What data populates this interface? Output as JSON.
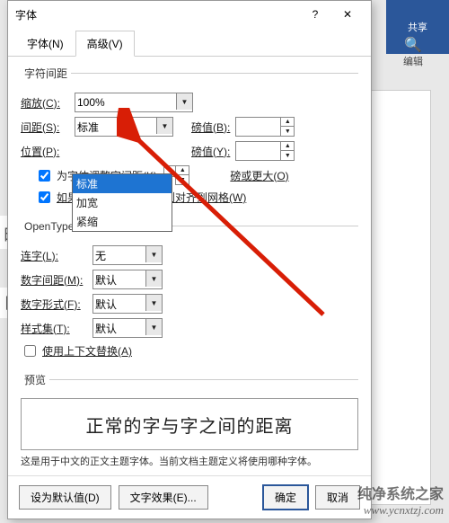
{
  "ribbon": {
    "share": "共享"
  },
  "edit_group": {
    "label": "编辑",
    "icon": "🔍"
  },
  "bg": {
    "left1": "的",
    "left2": "巨"
  },
  "dialog": {
    "title": "字体",
    "help": "?",
    "close": "✕",
    "tabs": {
      "font": "字体(N)",
      "advanced": "高级(V)"
    },
    "char_spacing": {
      "legend": "字符间距",
      "scale_label": "缩放(C):",
      "scale_value": "100%",
      "spacing_label": "间距(S):",
      "spacing_value": "标准",
      "spacing_options": {
        "standard": "标准",
        "expanded": "加宽",
        "condensed": "紧缩"
      },
      "position_label": "位置(P):",
      "position_value": "",
      "by_label_b": "磅值(B):",
      "by_label_y": "磅值(Y):",
      "by_value_b": "",
      "by_value_y": "",
      "kerning_label": "为字体调整字间距(K):",
      "kerning_value": "",
      "kerning_unit": "磅或更大(O)",
      "snap_label": "如果定义了文档网格，则对齐到网格(W)"
    },
    "opentype": {
      "legend": "OpenType 功能",
      "ligatures_label": "连字(L):",
      "ligatures_value": "无",
      "numspacing_label": "数字间距(M):",
      "numspacing_value": "默认",
      "numform_label": "数字形式(F):",
      "numform_value": "默认",
      "stylistic_label": "样式集(T):",
      "stylistic_value": "默认",
      "contextual_label": "使用上下文替换(A)"
    },
    "preview": {
      "legend": "预览",
      "sample": "正常的字与字之间的距离",
      "desc": "这是用于中文的正文主题字体。当前文档主题定义将使用哪种字体。"
    },
    "footer": {
      "default": "设为默认值(D)",
      "text_effects": "文字效果(E)...",
      "ok": "确定",
      "cancel": "取消"
    }
  },
  "watermark": {
    "line1": "纯净系统之家",
    "line2": "www.ycnxtzj.com"
  }
}
